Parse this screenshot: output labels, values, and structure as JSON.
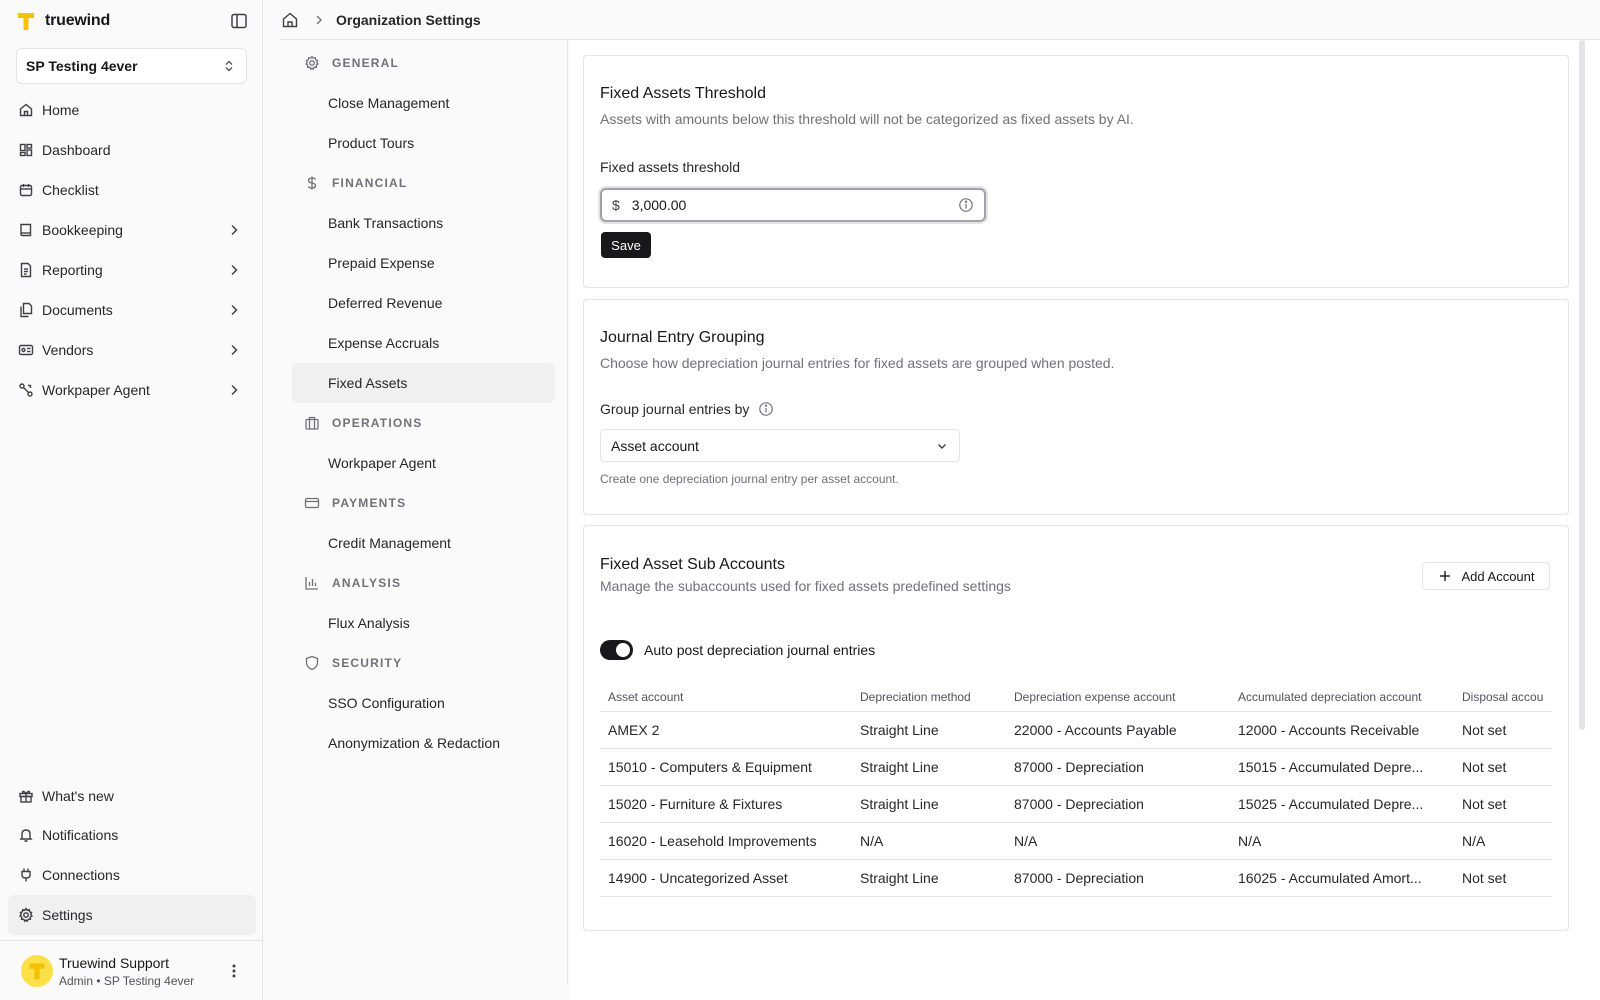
{
  "brand": {
    "name": "truewind"
  },
  "org": {
    "name": "SP Testing 4ever"
  },
  "nav": [
    {
      "label": "Home",
      "icon": "home-icon",
      "chevron": false
    },
    {
      "label": "Dashboard",
      "icon": "dashboard-icon",
      "chevron": false
    },
    {
      "label": "Checklist",
      "icon": "calendar-check-icon",
      "chevron": false
    },
    {
      "label": "Bookkeeping",
      "icon": "book-icon",
      "chevron": true
    },
    {
      "label": "Reporting",
      "icon": "report-icon",
      "chevron": true
    },
    {
      "label": "Documents",
      "icon": "documents-icon",
      "chevron": true
    },
    {
      "label": "Vendors",
      "icon": "vendor-icon",
      "chevron": true
    },
    {
      "label": "Workpaper Agent",
      "icon": "workpaper-agent-icon",
      "chevron": true
    }
  ],
  "nav_bottom": [
    {
      "label": "What's new",
      "icon": "gift-icon"
    },
    {
      "label": "Notifications",
      "icon": "bell-icon"
    },
    {
      "label": "Connections",
      "icon": "plug-icon"
    },
    {
      "label": "Settings",
      "icon": "gear-icon"
    }
  ],
  "user": {
    "name": "Truewind Support",
    "role": "Admin • SP Testing 4ever"
  },
  "breadcrumb": {
    "title": "Organization Settings"
  },
  "settings_nav": [
    {
      "section": "GENERAL",
      "icon": "gear-icon",
      "items": [
        "Close Management",
        "Product Tours"
      ]
    },
    {
      "section": "FINANCIAL",
      "icon": "dollar-icon",
      "items": [
        "Bank Transactions",
        "Prepaid Expense",
        "Deferred Revenue",
        "Expense Accruals",
        "Fixed Assets"
      ]
    },
    {
      "section": "OPERATIONS",
      "icon": "briefcase-icon",
      "items": [
        "Workpaper Agent"
      ]
    },
    {
      "section": "PAYMENTS",
      "icon": "credit-card-icon",
      "items": [
        "Credit Management"
      ]
    },
    {
      "section": "ANALYSIS",
      "icon": "bar-chart-icon",
      "items": [
        "Flux Analysis"
      ]
    },
    {
      "section": "SECURITY",
      "icon": "shield-icon",
      "items": [
        "SSO Configuration",
        "Anonymization & Redaction"
      ]
    }
  ],
  "active_setting": "Fixed Assets",
  "threshold": {
    "title": "Fixed Assets Threshold",
    "desc": "Assets with amounts below this threshold will not be categorized as fixed assets by AI.",
    "label": "Fixed assets threshold",
    "currency": "$",
    "value": "3,000.00",
    "save": "Save"
  },
  "grouping": {
    "title": "Journal Entry Grouping",
    "desc": "Choose how depreciation journal entries for fixed assets are grouped when posted.",
    "label": "Group journal entries by",
    "selected": "Asset account",
    "help": "Create one depreciation journal entry per asset account."
  },
  "sub_accounts": {
    "title": "Fixed Asset Sub Accounts",
    "desc": "Manage the subaccounts used for fixed assets predefined settings",
    "add_label": "Add Account",
    "toggle_label": "Auto post depreciation journal entries",
    "toggle_on": true,
    "columns": [
      "Asset account",
      "Depreciation method",
      "Depreciation expense account",
      "Accumulated depreciation account",
      "Disposal accou"
    ],
    "rows": [
      [
        "AMEX 2",
        "Straight Line",
        "22000 - Accounts Payable",
        "12000 - Accounts Receivable",
        "Not set"
      ],
      [
        "15010 - Computers & Equipment",
        "Straight Line",
        "87000 - Depreciation",
        "15015 - Accumulated Depre...",
        "Not set"
      ],
      [
        "15020 - Furniture & Fixtures",
        "Straight Line",
        "87000 - Depreciation",
        "15025 - Accumulated Depre...",
        "Not set"
      ],
      [
        "16020 - Leasehold Improvements",
        "N/A",
        "N/A",
        "N/A",
        "N/A"
      ],
      [
        "14900 - Uncategorized Asset",
        "Straight Line",
        "87000 - Depreciation",
        "16025 - Accumulated Amort...",
        "Not set"
      ]
    ]
  }
}
